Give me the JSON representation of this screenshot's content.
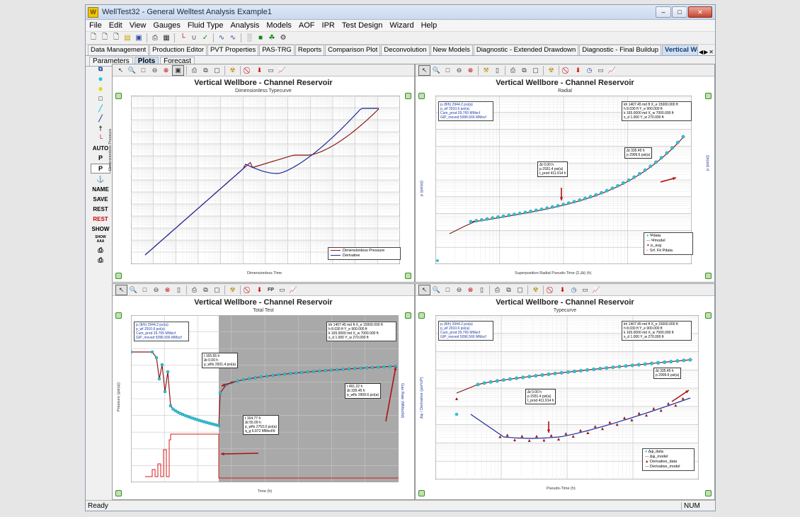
{
  "window": {
    "title": "WellTest32 - General Welltest Analysis Example1"
  },
  "menu": [
    "File",
    "Edit",
    "View",
    "Gauges",
    "Fluid Type",
    "Analysis",
    "Models",
    "AOF",
    "IPR",
    "Test Design",
    "Wizard",
    "Help"
  ],
  "tabs": [
    "Data Management",
    "Production Editor",
    "PVT Properties",
    "PAS-TRG",
    "Reports",
    "Comparison Plot",
    "Deconvolution",
    "New Models",
    "Diagnostic - Extended Drawdown",
    "Diagnostic - Final Buildup",
    "Vertical Wellbore - Channel Reservoir"
  ],
  "active_tab": "Vertical Wellbore - Channel Reservoir",
  "subtabs": [
    "Parameters",
    "Plots",
    "Forecast"
  ],
  "active_subtab": "Plots",
  "left_tools": {
    "auto": "AUTO",
    "p1": "P",
    "p2": "P",
    "name": "NAME",
    "save": "SAVE",
    "rest1": "REST",
    "rest2": "REST",
    "show": "SHOW",
    "show_aa": "SHOW AAA"
  },
  "panel_tl": {
    "title": "Vertical Wellbore - Channel Reservoir",
    "subtitle": "Dimensionless Typecurve",
    "ylabel": "Dimensionless Pressure",
    "xlabel": "Dimensionless Time",
    "legend": [
      "Dimensionless Pressure",
      "Derivative"
    ],
    "colors": {
      "pressure": "#8b1a1a",
      "derivative": "#1e2a9a"
    }
  },
  "panel_tr": {
    "title": "Vertical Wellbore - Channel Reservoir",
    "subtitle": "Radial",
    "ylabel": "p (psi(a))",
    "y2label": "p (psi(a))",
    "xlabel": "Superposition Radial Pseudo-Time (Σ,Δt) (h)",
    "info_left": [
      "pᵢ (ft/h)   2944.2  psi(a)",
      "p_wf   2910.6  psi(a)",
      "Cum_prod   29.765  MMscf",
      "GIP_moved   5096.566  MMscf"
    ],
    "info_right": [
      "kh   1407.45 md ft   X_e   15000.000 ft",
      "h   8.030 ft   Y_e   900.000 ft",
      "k   165.0000 md   X_w   7000.000 ft",
      "s_d   1.000   Y_w   270.000 ft"
    ],
    "anno1": [
      "Δt   0.00 h",
      "p   2931.4 psi(a)",
      "t_prod   411.914 h"
    ],
    "anno2": [
      "Δt   335.45 h",
      "p   2909.6 psi(a)"
    ],
    "legend": [
      "Ψdata",
      "Ψmodel",
      "p_avg",
      "Srf. Fit Pdata"
    ]
  },
  "panel_bl": {
    "title": "Vertical Wellbore - Channel Reservoir",
    "subtitle": "Total Test",
    "ylabel": "Pressure (psi(a))",
    "y2label": "Gas Rate (MMscf/d)",
    "xlabel": "Time (h)",
    "info_left": [
      "pᵢ (ft/h)   2944.2  psi(a)",
      "p_wf   2910.6  psi(a)",
      "Cum_prod   29.765  MMscf",
      "GIP_moved   5096.566  MMscf"
    ],
    "info_right": [
      "kh   1407.45 md ft   X_e   15000.000 ft",
      "h   8.030 ft   Y_e   900.000 ft",
      "k   165.0000 md   X_w   7000.000 ft",
      "s_d   1.000   Y_w   270.000 ft"
    ],
    "anno1": [
      "t   165.65 h",
      "Δt   0.00 h",
      "p_wflo   2931.4 psi(a)"
    ],
    "anno2": [
      "t   164.77 h",
      "Δt   55.09 h",
      "p_wflo   2753.0 psi(a)",
      "q_g   6.972 MMscf/d"
    ],
    "anno3": [
      "t   491.22 h",
      "Δt   335.45 h",
      "p_wflo   2909.6 psi(a)"
    ]
  },
  "panel_br": {
    "title": "Vertical Wellbore - Channel Reservoir",
    "subtitle": "Typecurve",
    "ylabel": "Δψ / Derivative (psi²/cP)",
    "xlabel": "Pseudo-Time (h)",
    "info_left": [
      "pᵢ (ft/h)   2944.2  psi(a)",
      "p_wf   2910.6  psi(a)",
      "Cum_prod   29.765  MMscf",
      "GIP_moved   5096.566  MMscf"
    ],
    "info_right": [
      "kh   1407.45 md ft   X_e   15000.000 ft",
      "h   8.030 ft   Y_e   900.000 ft",
      "k   165.0000 md   X_w   7000.000 ft",
      "s_d   1.000   Y_w   270.000 ft"
    ],
    "anno1": [
      "Δt   0.00 h",
      "p   2931.4 psi(a)",
      "t_prod   411.914 h"
    ],
    "anno2": [
      "Δt   335.45 h",
      "p   2909.6 psi(a)"
    ],
    "legend": [
      "Δψ_data",
      "Δψ_model",
      "Derivative_data",
      "Derivative_model"
    ]
  },
  "statusbar": {
    "left": "Ready",
    "num": "NUM"
  }
}
